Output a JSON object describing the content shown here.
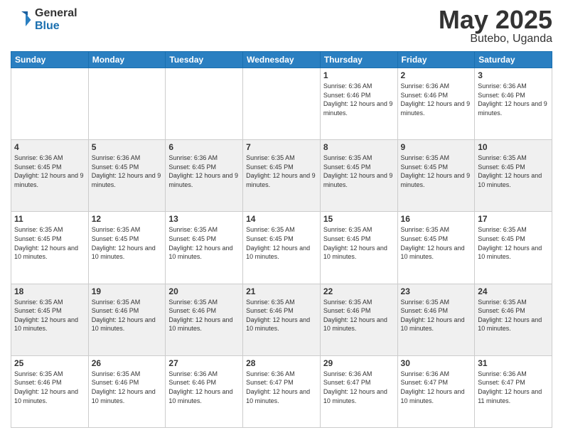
{
  "logo": {
    "general": "General",
    "blue": "Blue"
  },
  "title": {
    "month_year": "May 2025",
    "location": "Butebo, Uganda"
  },
  "weekdays": [
    "Sunday",
    "Monday",
    "Tuesday",
    "Wednesday",
    "Thursday",
    "Friday",
    "Saturday"
  ],
  "weeks": [
    [
      {
        "day": "",
        "info": ""
      },
      {
        "day": "",
        "info": ""
      },
      {
        "day": "",
        "info": ""
      },
      {
        "day": "",
        "info": ""
      },
      {
        "day": "1",
        "info": "Sunrise: 6:36 AM\nSunset: 6:46 PM\nDaylight: 12 hours and 9 minutes."
      },
      {
        "day": "2",
        "info": "Sunrise: 6:36 AM\nSunset: 6:46 PM\nDaylight: 12 hours and 9 minutes."
      },
      {
        "day": "3",
        "info": "Sunrise: 6:36 AM\nSunset: 6:46 PM\nDaylight: 12 hours and 9 minutes."
      }
    ],
    [
      {
        "day": "4",
        "info": "Sunrise: 6:36 AM\nSunset: 6:45 PM\nDaylight: 12 hours and 9 minutes."
      },
      {
        "day": "5",
        "info": "Sunrise: 6:36 AM\nSunset: 6:45 PM\nDaylight: 12 hours and 9 minutes."
      },
      {
        "day": "6",
        "info": "Sunrise: 6:36 AM\nSunset: 6:45 PM\nDaylight: 12 hours and 9 minutes."
      },
      {
        "day": "7",
        "info": "Sunrise: 6:35 AM\nSunset: 6:45 PM\nDaylight: 12 hours and 9 minutes."
      },
      {
        "day": "8",
        "info": "Sunrise: 6:35 AM\nSunset: 6:45 PM\nDaylight: 12 hours and 9 minutes."
      },
      {
        "day": "9",
        "info": "Sunrise: 6:35 AM\nSunset: 6:45 PM\nDaylight: 12 hours and 9 minutes."
      },
      {
        "day": "10",
        "info": "Sunrise: 6:35 AM\nSunset: 6:45 PM\nDaylight: 12 hours and 10 minutes."
      }
    ],
    [
      {
        "day": "11",
        "info": "Sunrise: 6:35 AM\nSunset: 6:45 PM\nDaylight: 12 hours and 10 minutes."
      },
      {
        "day": "12",
        "info": "Sunrise: 6:35 AM\nSunset: 6:45 PM\nDaylight: 12 hours and 10 minutes."
      },
      {
        "day": "13",
        "info": "Sunrise: 6:35 AM\nSunset: 6:45 PM\nDaylight: 12 hours and 10 minutes."
      },
      {
        "day": "14",
        "info": "Sunrise: 6:35 AM\nSunset: 6:45 PM\nDaylight: 12 hours and 10 minutes."
      },
      {
        "day": "15",
        "info": "Sunrise: 6:35 AM\nSunset: 6:45 PM\nDaylight: 12 hours and 10 minutes."
      },
      {
        "day": "16",
        "info": "Sunrise: 6:35 AM\nSunset: 6:45 PM\nDaylight: 12 hours and 10 minutes."
      },
      {
        "day": "17",
        "info": "Sunrise: 6:35 AM\nSunset: 6:45 PM\nDaylight: 12 hours and 10 minutes."
      }
    ],
    [
      {
        "day": "18",
        "info": "Sunrise: 6:35 AM\nSunset: 6:45 PM\nDaylight: 12 hours and 10 minutes."
      },
      {
        "day": "19",
        "info": "Sunrise: 6:35 AM\nSunset: 6:46 PM\nDaylight: 12 hours and 10 minutes."
      },
      {
        "day": "20",
        "info": "Sunrise: 6:35 AM\nSunset: 6:46 PM\nDaylight: 12 hours and 10 minutes."
      },
      {
        "day": "21",
        "info": "Sunrise: 6:35 AM\nSunset: 6:46 PM\nDaylight: 12 hours and 10 minutes."
      },
      {
        "day": "22",
        "info": "Sunrise: 6:35 AM\nSunset: 6:46 PM\nDaylight: 12 hours and 10 minutes."
      },
      {
        "day": "23",
        "info": "Sunrise: 6:35 AM\nSunset: 6:46 PM\nDaylight: 12 hours and 10 minutes."
      },
      {
        "day": "24",
        "info": "Sunrise: 6:35 AM\nSunset: 6:46 PM\nDaylight: 12 hours and 10 minutes."
      }
    ],
    [
      {
        "day": "25",
        "info": "Sunrise: 6:35 AM\nSunset: 6:46 PM\nDaylight: 12 hours and 10 minutes."
      },
      {
        "day": "26",
        "info": "Sunrise: 6:35 AM\nSunset: 6:46 PM\nDaylight: 12 hours and 10 minutes."
      },
      {
        "day": "27",
        "info": "Sunrise: 6:36 AM\nSunset: 6:46 PM\nDaylight: 12 hours and 10 minutes."
      },
      {
        "day": "28",
        "info": "Sunrise: 6:36 AM\nSunset: 6:47 PM\nDaylight: 12 hours and 10 minutes."
      },
      {
        "day": "29",
        "info": "Sunrise: 6:36 AM\nSunset: 6:47 PM\nDaylight: 12 hours and 10 minutes."
      },
      {
        "day": "30",
        "info": "Sunrise: 6:36 AM\nSunset: 6:47 PM\nDaylight: 12 hours and 10 minutes."
      },
      {
        "day": "31",
        "info": "Sunrise: 6:36 AM\nSunset: 6:47 PM\nDaylight: 12 hours and 11 minutes."
      }
    ]
  ]
}
